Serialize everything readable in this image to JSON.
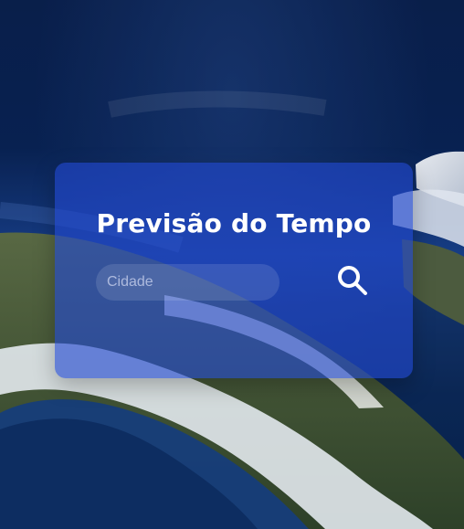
{
  "background": {
    "image_description": "satellite-earth-alaska"
  },
  "weather_card": {
    "title": "Previsão do Tempo",
    "search": {
      "placeholder": "Cidade",
      "value": "",
      "button_icon": "search-icon"
    }
  },
  "colors": {
    "card_background": "#2248d2",
    "text": "#ffffff",
    "input_background": "#4c6fd7",
    "placeholder": "#e6ebff"
  }
}
